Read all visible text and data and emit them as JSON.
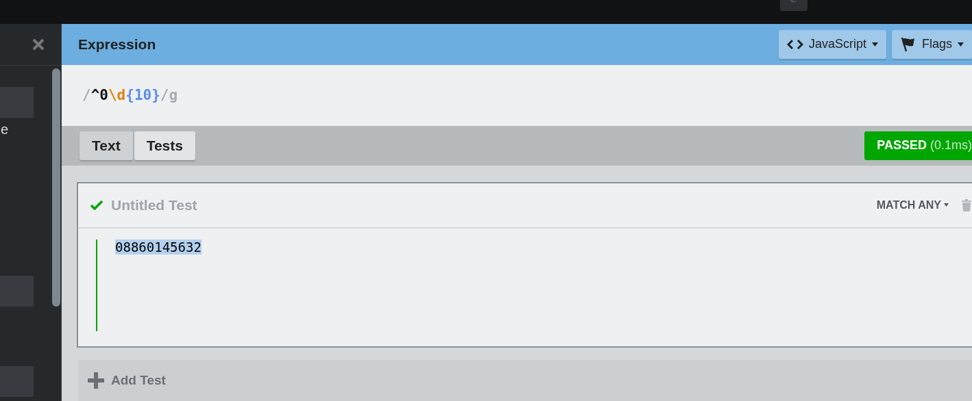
{
  "sidebar": {
    "items": [
      {
        "label": "e"
      }
    ]
  },
  "header": {
    "title": "Expression",
    "buttons": [
      {
        "kind": "code",
        "label": "JavaScript"
      },
      {
        "kind": "flag",
        "label": "Flags"
      }
    ]
  },
  "expression": [
    {
      "kind": "delimiter",
      "text": "/"
    },
    {
      "kind": "anchor",
      "text": "^"
    },
    {
      "kind": "char",
      "text": "0"
    },
    {
      "kind": "escape",
      "text": "\\d"
    },
    {
      "kind": "quantifier",
      "text": "{10}"
    },
    {
      "kind": "delimiter",
      "text": "/"
    },
    {
      "kind": "flags",
      "text": "g"
    }
  ],
  "tabs": [
    {
      "label": "Text",
      "selected": false
    },
    {
      "label": "Tests",
      "selected": true
    }
  ],
  "result": {
    "status": "PASSED",
    "time": "(0.1ms)",
    "passed": true
  },
  "tests": [
    {
      "title": "Untitled Test",
      "passed": true,
      "mode": "MATCH ANY",
      "text": "08860145632"
    }
  ],
  "add_test": "Add Test"
}
